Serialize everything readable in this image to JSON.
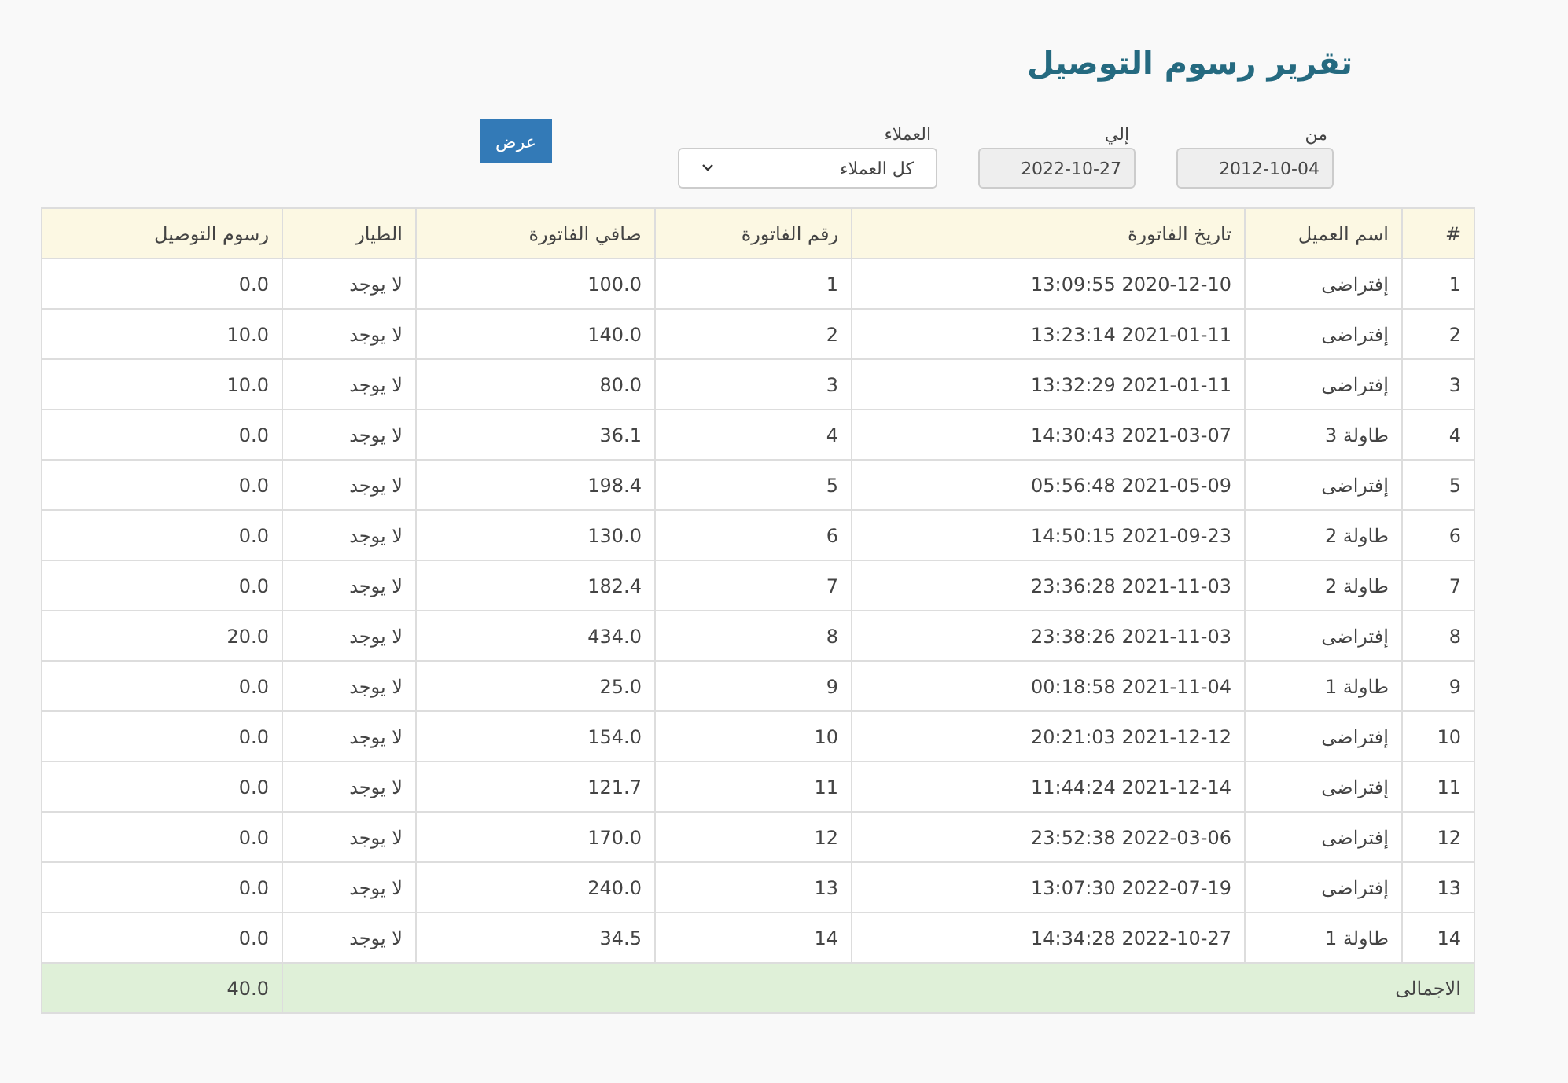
{
  "title": "تقرير رسوم التوصيل",
  "filters": {
    "from": {
      "label": "من",
      "value": "2012-10-04"
    },
    "to": {
      "label": "إلي",
      "value": "2022-10-27"
    },
    "customers": {
      "label": "العملاء",
      "value": "كل العملاء"
    },
    "button": "عرض"
  },
  "table": {
    "columns": [
      "#",
      "اسم العميل",
      "تاريخ الفاتورة",
      "رقم الفاتورة",
      "صافي الفاتورة",
      "الطيار",
      "رسوم التوصيل"
    ],
    "rows": [
      [
        "1",
        "إفتراضى",
        "2020-12-10 13:09:55",
        "1",
        "100.0",
        "لا يوجد",
        "0.0"
      ],
      [
        "2",
        "إفتراضى",
        "2021-01-11 13:23:14",
        "2",
        "140.0",
        "لا يوجد",
        "10.0"
      ],
      [
        "3",
        "إفتراضى",
        "2021-01-11 13:32:29",
        "3",
        "80.0",
        "لا يوجد",
        "10.0"
      ],
      [
        "4",
        "طاولة 3",
        "2021-03-07 14:30:43",
        "4",
        "36.1",
        "لا يوجد",
        "0.0"
      ],
      [
        "5",
        "إفتراضى",
        "2021-05-09 05:56:48",
        "5",
        "198.4",
        "لا يوجد",
        "0.0"
      ],
      [
        "6",
        "طاولة 2",
        "2021-09-23 14:50:15",
        "6",
        "130.0",
        "لا يوجد",
        "0.0"
      ],
      [
        "7",
        "طاولة 2",
        "2021-11-03 23:36:28",
        "7",
        "182.4",
        "لا يوجد",
        "0.0"
      ],
      [
        "8",
        "إفتراضى",
        "2021-11-03 23:38:26",
        "8",
        "434.0",
        "لا يوجد",
        "20.0"
      ],
      [
        "9",
        "طاولة 1",
        "2021-11-04 00:18:58",
        "9",
        "25.0",
        "لا يوجد",
        "0.0"
      ],
      [
        "10",
        "إفتراضى",
        "2021-12-12 20:21:03",
        "10",
        "154.0",
        "لا يوجد",
        "0.0"
      ],
      [
        "11",
        "إفتراضى",
        "2021-12-14 11:44:24",
        "11",
        "121.7",
        "لا يوجد",
        "0.0"
      ],
      [
        "12",
        "إفتراضى",
        "2022-03-06 23:52:38",
        "12",
        "170.0",
        "لا يوجد",
        "0.0"
      ],
      [
        "13",
        "إفتراضى",
        "2022-07-19 13:07:30",
        "13",
        "240.0",
        "لا يوجد",
        "0.0"
      ],
      [
        "14",
        "طاولة 1",
        "2022-10-27 14:34:28",
        "14",
        "34.5",
        "لا يوجد",
        "0.0"
      ]
    ],
    "total": {
      "label": "الاجمالى",
      "value": "40.0"
    }
  }
}
